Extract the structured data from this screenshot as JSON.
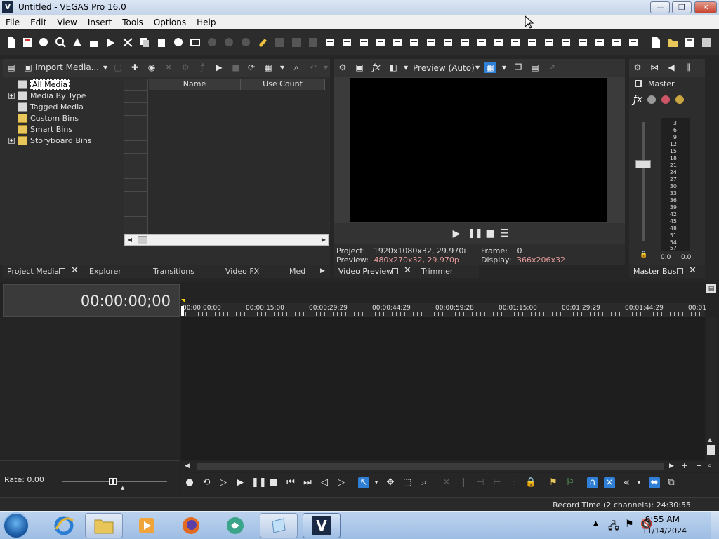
{
  "window": {
    "title": "Untitled - VEGAS Pro 16.0",
    "app_icon_letter": "V",
    "min_label": "—",
    "max_label": "❐",
    "close_label": "✕"
  },
  "menu": [
    "File",
    "Edit",
    "View",
    "Insert",
    "Tools",
    "Options",
    "Help"
  ],
  "project_media": {
    "import_label": "Import Media...",
    "tree": [
      {
        "label": "All Media",
        "expandable": false,
        "selected": true
      },
      {
        "label": "Media By Type",
        "expandable": true,
        "selected": false
      },
      {
        "label": "Tagged Media",
        "expandable": false,
        "selected": false
      },
      {
        "label": "Custom Bins",
        "expandable": false,
        "selected": false
      },
      {
        "label": "Smart Bins",
        "expandable": false,
        "selected": false
      },
      {
        "label": "Storyboard Bins",
        "expandable": true,
        "selected": false
      }
    ],
    "columns": [
      "Name",
      "Use Count"
    ],
    "tabs": [
      "Project Media",
      "Explorer",
      "Transitions",
      "Video FX",
      "Med"
    ]
  },
  "video_preview": {
    "quality_label": "Preview (Auto)",
    "project_label": "Project:",
    "project_value": "1920x1080x32, 29.970i",
    "preview_label": "Preview:",
    "preview_value": "480x270x32, 29.970p",
    "frame_label": "Frame:",
    "frame_value": "0",
    "display_label": "Display:",
    "display_value": "366x206x32",
    "tabs": [
      "Video Preview",
      "Trimmer"
    ]
  },
  "master_bus": {
    "label": "Master",
    "scale": [
      "3",
      "6",
      "9",
      "12",
      "15",
      "18",
      "21",
      "24",
      "27",
      "30",
      "33",
      "36",
      "39",
      "42",
      "45",
      "48",
      "51",
      "54",
      "57"
    ],
    "left_value": "0.0",
    "right_value": "0.0",
    "tab": "Master Bus"
  },
  "timeline": {
    "timecode": "00:00:00;00",
    "ruler": [
      "00:00:00;00",
      "00:00:15;00",
      "00:00:29;29",
      "00:00:44;29",
      "00:00:59;28",
      "00:01:15;00",
      "00:01:29;29",
      "00:01:44;29",
      "00:01"
    ],
    "rate_label": "Rate: 0.00"
  },
  "status": {
    "record_time": "Record Time (2 channels): 24:30:55"
  },
  "taskbar": {
    "time": "8:55 AM",
    "date": "11/14/2024"
  },
  "colors": {
    "accent_blue": "#2f7fd6",
    "preview_value_pink": "#e39a9a",
    "panel_bg": "#2d2d2d"
  }
}
